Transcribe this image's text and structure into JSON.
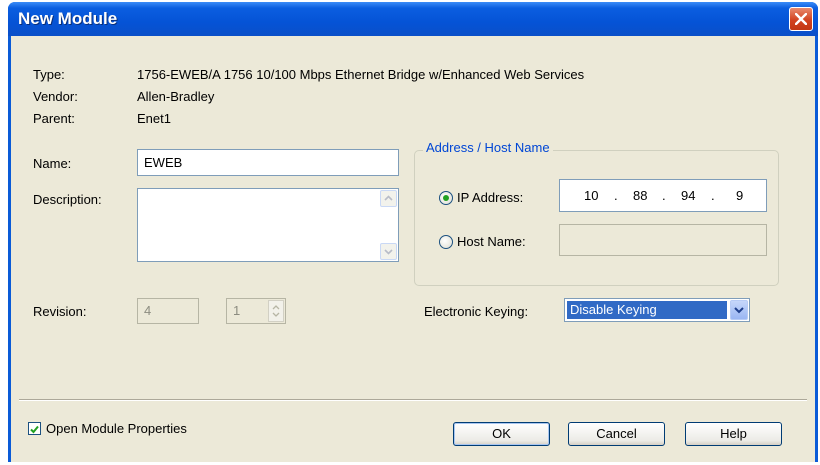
{
  "window": {
    "title": "New Module"
  },
  "info": {
    "type_label": "Type:",
    "type_value": "1756-EWEB/A 1756 10/100 Mbps Ethernet Bridge w/Enhanced Web Services",
    "vendor_label": "Vendor:",
    "vendor_value": "Allen-Bradley",
    "parent_label": "Parent:",
    "parent_value": "Enet1"
  },
  "form": {
    "name_label": "Name:",
    "name_value": "EWEB",
    "description_label": "Description:",
    "description_value": "",
    "revision_label": "Revision:",
    "revision_major": "4",
    "revision_minor": "1"
  },
  "address": {
    "group_title": "Address / Host Name",
    "ip_label": "IP Address:",
    "ip_selected": true,
    "ip_octets": [
      "10",
      "88",
      "94",
      "9"
    ],
    "ip_separator": ".",
    "host_label": "Host Name:",
    "host_value": ""
  },
  "keying": {
    "label": "Electronic Keying:",
    "selected": "Disable Keying"
  },
  "footer": {
    "open_props_label": "Open Module Properties",
    "open_props_checked": true,
    "ok_label": "OK",
    "cancel_label": "Cancel",
    "help_label": "Help"
  },
  "colors": {
    "titlebar": "#0553d6",
    "dialog_bg": "#ece9d8",
    "group_title": "#0046d5",
    "selection": "#316ac5",
    "radio_dot": "#21a121"
  }
}
